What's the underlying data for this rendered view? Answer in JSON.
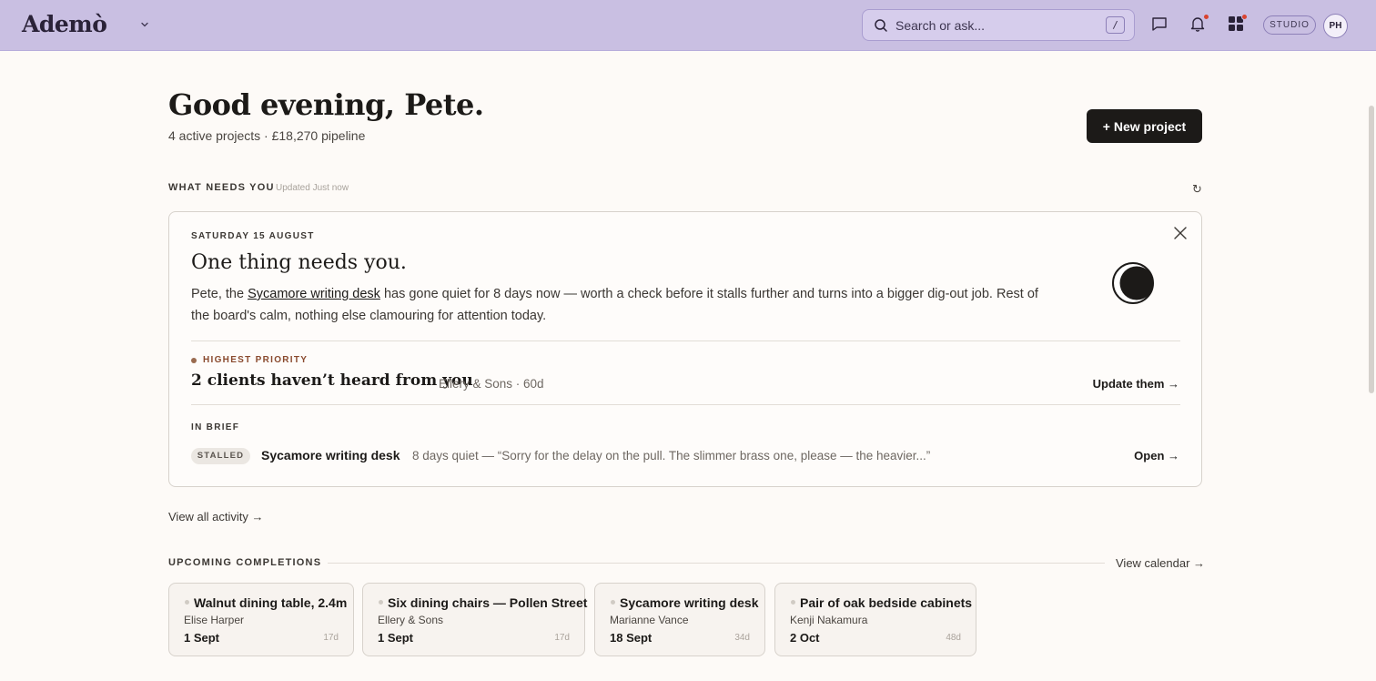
{
  "app": {
    "logo": "Ademò",
    "search_placeholder": "Search or ask...",
    "search_shortcut": "/",
    "studio_label": "STUDIO",
    "avatar_initials": "PH"
  },
  "greeting": {
    "title": "Good evening, Pete.",
    "summary": "4 active projects · £18,270 pipeline",
    "new_project_label": "+ New project"
  },
  "needs_you": {
    "section_label": "WHAT NEEDS YOU",
    "updated": "Updated Just now",
    "refresh_icon": "↻",
    "date": "SATURDAY 15 AUGUST",
    "title": "One thing needs you.",
    "body_prefix": "Pete, the ",
    "body_link": "Sycamore writing desk",
    "body_suffix": " has gone quiet for 8 days now — worth a check before it stalls further and turns into a bigger dig-out job. Rest of the board's calm, nothing else clamouring for attention today.",
    "priority_label": "HIGHEST PRIORITY",
    "priority_title": "2 clients haven’t heard from you",
    "priority_meta": "Ellery & Sons · 60d",
    "priority_action": "Update them →",
    "brief_label": "IN BRIEF",
    "brief_status": "STALLED",
    "brief_title": "Sycamore writing desk",
    "brief_meta": "8 days quiet — “Sorry for the delay on the pull. The slimmer brass one, please — the heavier...”",
    "brief_action": "Open →"
  },
  "view_all_activity": "View all activity →",
  "upcoming": {
    "section_label": "UPCOMING COMPLETIONS",
    "view_calendar": "View calendar →",
    "items": [
      {
        "title": "Walnut dining table, 2.4m",
        "client": "Elise Harper",
        "date": "1 Sept",
        "days": "17d"
      },
      {
        "title": "Six dining chairs — Pollen Street",
        "client": "Ellery & Sons",
        "date": "1 Sept",
        "days": "17d"
      },
      {
        "title": "Sycamore writing desk",
        "client": "Marianne Vance",
        "date": "18 Sept",
        "days": "34d"
      },
      {
        "title": "Pair of oak bedside cabinets",
        "client": "Kenji Nakamura",
        "date": "2 Oct",
        "days": "48d"
      }
    ]
  },
  "colors": {
    "topbar": "#c9bfe2",
    "accent_dark": "#1c1a18",
    "notification_dot": "#d9432f",
    "priority": "#8a4a2e"
  }
}
